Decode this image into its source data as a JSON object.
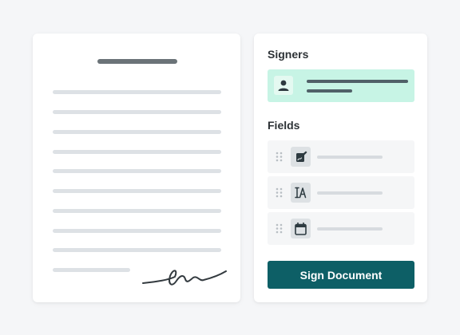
{
  "signers_panel": {
    "title": "Signers",
    "signer": {
      "icon": "user-icon"
    }
  },
  "fields_panel": {
    "title": "Fields",
    "fields": [
      {
        "icon": "signature-field-icon"
      },
      {
        "icon": "text-field-icon"
      },
      {
        "icon": "date-field-icon"
      }
    ]
  },
  "actions": {
    "sign_label": "Sign Document"
  },
  "colors": {
    "background": "#f5f6f8",
    "card": "#ffffff",
    "accent_button": "#0d5f66",
    "selected_signer": "#c7f4e5",
    "heading_text": "#2d3236",
    "placeholder_line": "#dde1e5"
  }
}
